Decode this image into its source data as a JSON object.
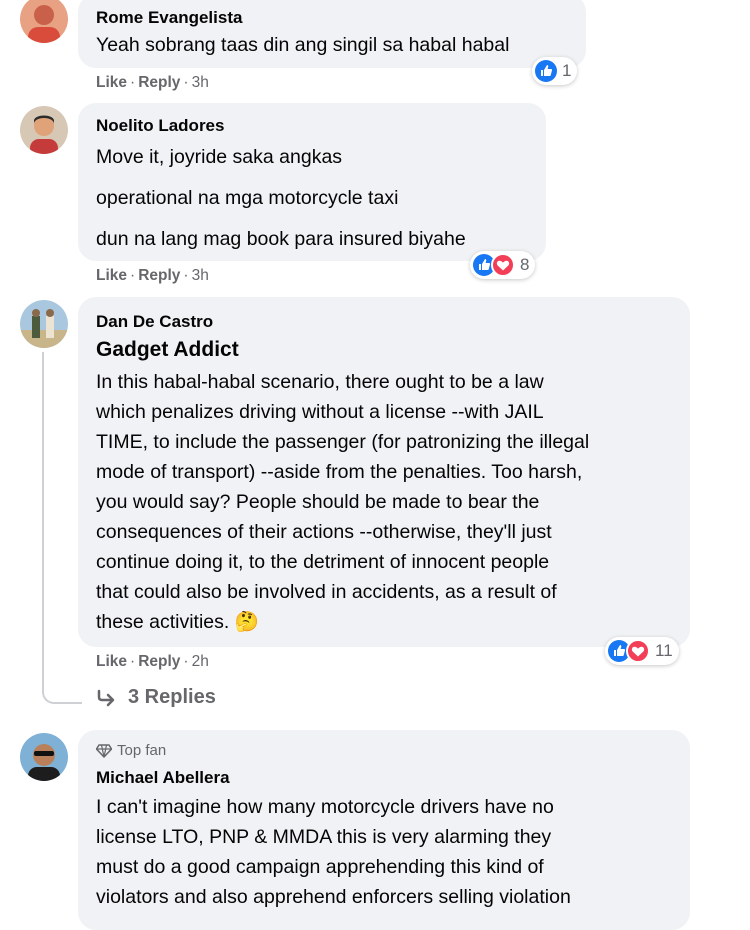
{
  "comments": [
    {
      "author": "Rome Evangelista",
      "text": "Yeah sobrang taas din ang singil sa habal habal",
      "actions": {
        "like": "Like",
        "reply": "Reply",
        "time": "3h"
      },
      "reaction_count": "1",
      "reactions": [
        "like-icon"
      ]
    },
    {
      "author": "Noelito Ladores",
      "lines": [
        "Move it, joyride saka angkas",
        "operational na mga motorcycle taxi",
        "dun na lang mag book para insured biyahe"
      ],
      "actions": {
        "like": "Like",
        "reply": "Reply",
        "time": "3h"
      },
      "reaction_count": "8",
      "reactions": [
        "like-icon",
        "love-icon"
      ]
    },
    {
      "author": "Dan De Castro",
      "headline": "Gadget Addict",
      "lines": [
        "In this habal-habal scenario, there ought to be a law",
        "which penalizes driving without a license --with JAIL",
        "TIME, to include the passenger (for patronizing the illegal",
        "mode of transport) --aside from the penalties. Too harsh,",
        "you would say? People should be made to bear the",
        "consequences of their actions --otherwise, they'll just",
        "continue doing it, to the detriment of innocent people",
        "that could also be involved in accidents, as a result of",
        "these activities."
      ],
      "emoji": "🤔",
      "actions": {
        "like": "Like",
        "reply": "Reply",
        "time": "2h"
      },
      "reaction_count": "11",
      "reactions": [
        "like-icon",
        "love-icon"
      ],
      "replies_label": "3 Replies"
    },
    {
      "badge": "Top fan",
      "author": "Michael Abellera",
      "lines": [
        "I can't imagine how many motorcycle drivers have no",
        "license LTO, PNP & MMDA this is very alarming they",
        "must do a good campaign apprehending this kind of",
        "violators and also apprehend enforcers selling violation"
      ]
    }
  ],
  "colors": {
    "like": "#1877f2",
    "love": "#f33e58",
    "bubble": "#f0f2f5",
    "meta": "#65676b"
  }
}
